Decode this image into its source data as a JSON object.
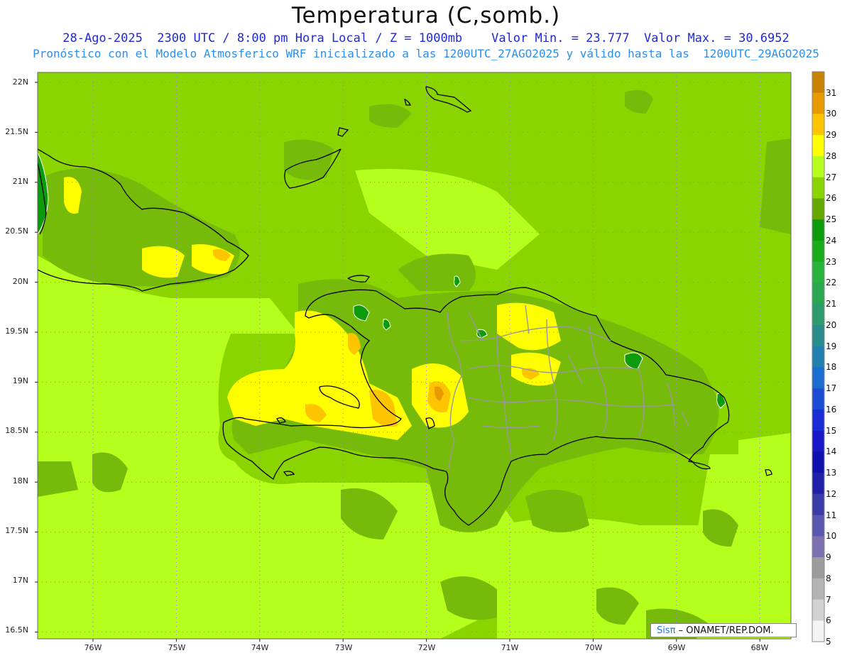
{
  "header": {
    "title": "Temperatura (C,somb.)",
    "line1": "28-Ago-2025  2300 UTC / 8:00 pm Hora Local / Z = 1000mb    Valor Min. = 23.777  Valor Max. = 30.6952",
    "line2": "Pronóstico con el Modelo Atmosferico WRF inicializado a las 1200UTC_27AGO2025 y válido hasta las  1200UTC_29AGO2025"
  },
  "axes": {
    "lat_labels": [
      "22N",
      "21.5N",
      "21N",
      "20.5N",
      "20N",
      "19.5N",
      "19N",
      "18.5N",
      "18N",
      "17.5N",
      "17N",
      "16.5N"
    ],
    "lon_labels": [
      "76W",
      "75W",
      "74W",
      "73W",
      "72W",
      "71W",
      "70W",
      "69W",
      "68W"
    ]
  },
  "colorbar": {
    "labels": [
      "31",
      "30",
      "29",
      "28",
      "27",
      "26",
      "25",
      "24",
      "23",
      "22",
      "21",
      "20",
      "19",
      "18",
      "17",
      "16",
      "15",
      "14",
      "13",
      "12",
      "11",
      "10",
      "9",
      "8",
      "7",
      "6",
      "5"
    ],
    "colors": [
      "#c88200",
      "#e89a00",
      "#ffc400",
      "#ffff00",
      "#b6ff1c",
      "#8ad400",
      "#66a800",
      "#0b9b0b",
      "#19ad19",
      "#28b43c",
      "#2aa850",
      "#2c9c6c",
      "#2a8c8c",
      "#2080b0",
      "#1a6cd0",
      "#1a4cd6",
      "#1a2cd8",
      "#1818c8",
      "#1010b0",
      "#2020a8",
      "#3c3ca8",
      "#5858b0",
      "#7c70b0",
      "#9c9c9c",
      "#b4b4b4",
      "#d2d2d2",
      "#f4f4f4"
    ]
  },
  "map": {
    "colors": {
      "background": "#8ad400",
      "t26": "#76ba0a",
      "t27": "#b6ff1c",
      "t28": "#ffff00",
      "t29": "#ffc400",
      "t30": "#e89a00",
      "t24": "#0b9b0b",
      "coast": "#000000",
      "border": "#999999",
      "grid": "#9a7ad8"
    }
  },
  "credit": {
    "brand": "Sisπ",
    "text": "– ONAMET/REP.DOM."
  }
}
